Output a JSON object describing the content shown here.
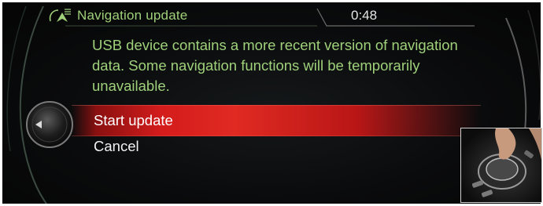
{
  "header": {
    "title": "Navigation update",
    "time": "0:48",
    "icon": "navigation-arrow-icon"
  },
  "dialog": {
    "message": "USB device contains a more recent version of navigation data. Some navigation functions will be temporarily unavailable.",
    "options": [
      {
        "label": "Start update",
        "selected": true
      },
      {
        "label": "Cancel",
        "selected": false
      }
    ]
  },
  "inset": {
    "icon": "idrive-controller-photo"
  },
  "colors": {
    "text_green": "#9fd07a",
    "highlight_red": "#d41c1c",
    "background": "#0a0b0c"
  }
}
